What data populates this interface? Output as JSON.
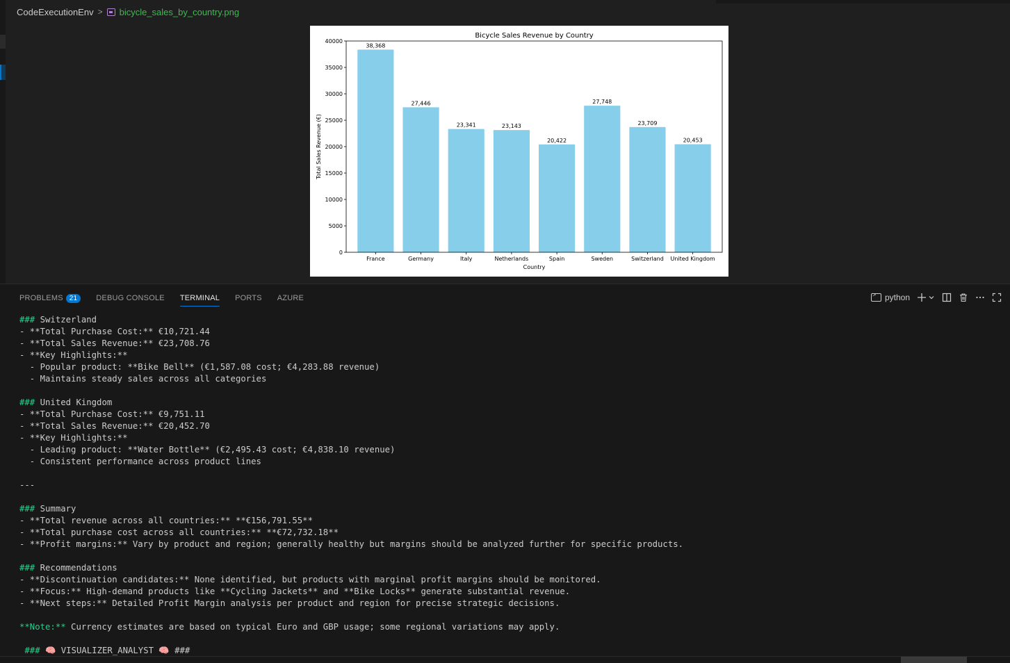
{
  "breadcrumb": {
    "root": "CodeExecutionEnv",
    "separator": ">",
    "file": "bicycle_sales_by_country.png",
    "file_icon": "image-file-icon"
  },
  "chart_data": {
    "type": "bar",
    "title": "Bicycle Sales Revenue by Country",
    "xlabel": "Country",
    "ylabel": "Total Sales Revenue (€)",
    "categories": [
      "France",
      "Germany",
      "Italy",
      "Netherlands",
      "Spain",
      "Sweden",
      "Switzerland",
      "United Kingdom"
    ],
    "values": [
      38368,
      27446,
      23341,
      23143,
      20422,
      27748,
      23709,
      20453
    ],
    "value_labels": [
      "38,368",
      "27,446",
      "23,341",
      "23,143",
      "20,422",
      "27,748",
      "23,709",
      "20,453"
    ],
    "ylim": [
      0,
      40000
    ],
    "yticks": [
      "0",
      "5000",
      "10000",
      "15000",
      "20000",
      "25000",
      "30000",
      "35000",
      "40000"
    ],
    "bar_color": "#87ceeb",
    "grid": false
  },
  "panel": {
    "tabs": [
      {
        "label": "PROBLEMS",
        "badge": "21"
      },
      {
        "label": "DEBUG CONSOLE"
      },
      {
        "label": "TERMINAL",
        "active": true
      },
      {
        "label": "PORTS"
      },
      {
        "label": "AZURE"
      }
    ],
    "terminal_name": "python"
  },
  "terminal": {
    "lines": [
      "### Switzerland",
      "- **Total Purchase Cost:** €10,721.44",
      "- **Total Sales Revenue:** €23,708.76",
      "- **Key Highlights:**",
      "  - Popular product: **Bike Bell** (€1,587.08 cost; €4,283.88 revenue)",
      "  - Maintains steady sales across all categories",
      "",
      "### United Kingdom",
      "- **Total Purchase Cost:** €9,751.11",
      "- **Total Sales Revenue:** €20,452.70",
      "- **Key Highlights:**",
      "  - Leading product: **Water Bottle** (€2,495.43 cost; €4,838.10 revenue)",
      "  - Consistent performance across product lines",
      "",
      "---",
      "",
      "### Summary",
      "- **Total revenue across all countries:** **€156,791.55**",
      "- **Total purchase cost across all countries:** **€72,732.18**",
      "- **Profit margins:** Vary by product and region; generally healthy but margins should be analyzed further for specific products.",
      "",
      "### Recommendations",
      "- **Discontinuation candidates:** None identified, but products with marginal profit margins should be monitored.",
      "- **Focus:** High-demand products like **Cycling Jackets** and **Bike Locks** generate substantial revenue.",
      "- **Next steps:** Detailed Profit Margin analysis per product and region for precise strategic decisions.",
      "",
      "**Note:** Currency estimates are based on typical Euro and GBP usage; some regional variations may apply.",
      "",
      " ### 🧠 VISUALIZER_ANALYST 🧠 ###"
    ]
  },
  "colors": {
    "accent": "#0078d4",
    "heading_green": "#23d18b",
    "filename_green": "#3fb950"
  }
}
